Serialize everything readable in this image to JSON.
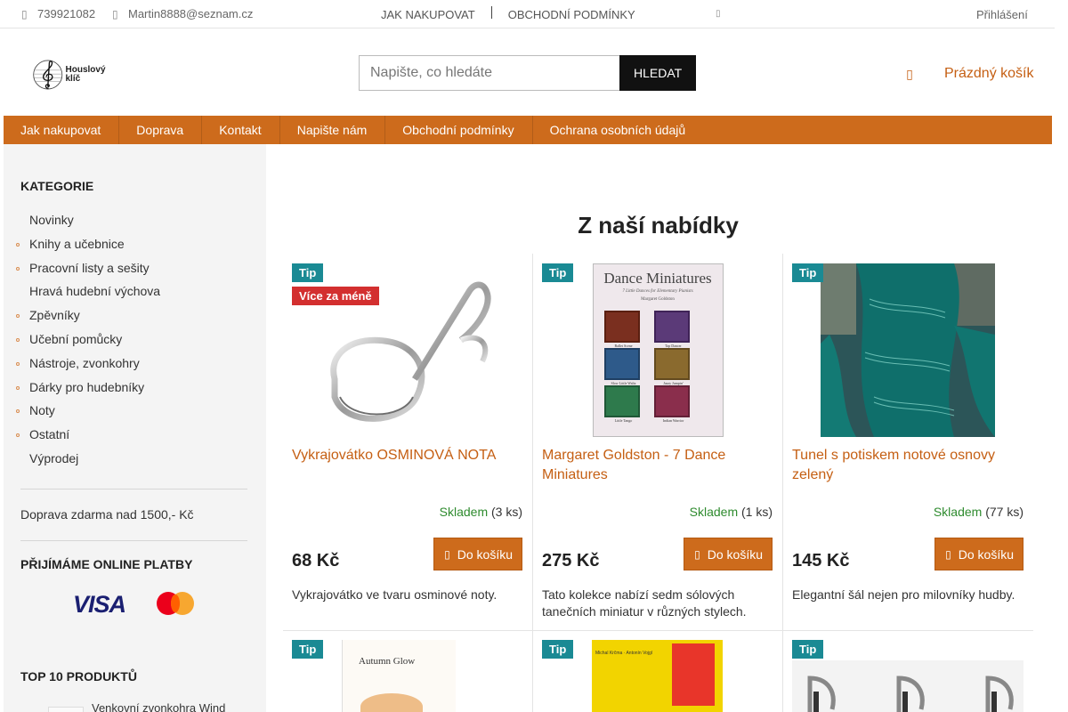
{
  "topbar": {
    "phone": "739921082",
    "email": "Martin8888@seznam.cz",
    "links": [
      "JAK NAKUPOVAT",
      "OBCHODNÍ PODMÍNKY"
    ],
    "login": "Přihlášení"
  },
  "header": {
    "logo_text": "Houslový klíč",
    "search_placeholder": "Napište, co hledáte",
    "search_button": "HLEDAT",
    "cart_text": "Prázdný košík"
  },
  "nav": [
    "Jak nakupovat",
    "Doprava",
    "Kontakt",
    "Napište nám",
    "Obchodní podmínky",
    "Ochrana osobních údajů"
  ],
  "sidebar": {
    "categories_heading": "KATEGORIE",
    "categories": [
      {
        "label": "Novinky",
        "bullet": false
      },
      {
        "label": "Knihy a učebnice",
        "bullet": true
      },
      {
        "label": "Pracovní listy a sešity",
        "bullet": true
      },
      {
        "label": "Hravá hudební výchova",
        "bullet": false
      },
      {
        "label": "Zpěvníky",
        "bullet": true
      },
      {
        "label": "Učební pomůcky",
        "bullet": true
      },
      {
        "label": "Nástroje, zvonkohry",
        "bullet": true
      },
      {
        "label": "Dárky pro hudebníky",
        "bullet": true
      },
      {
        "label": "Noty",
        "bullet": true
      },
      {
        "label": "Ostatní",
        "bullet": true
      },
      {
        "label": "Výprodej",
        "bullet": false
      }
    ],
    "shipping_note": "Doprava zdarma nad 1500,- Kč",
    "payments_heading": "PŘIJÍMÁME ONLINE PLATBY",
    "visa_text": "VISA",
    "top10_heading": "TOP 10 PRODUKTŮ",
    "top10_first": "Venkovní zvonkohra Wind"
  },
  "main": {
    "title": "Z naší nabídky",
    "products": [
      {
        "badges": [
          "Tip",
          "Více za méně"
        ],
        "name": "Vykrajovátko OSMINOVÁ NOTA",
        "stock_label": "Skladem",
        "stock_count": "(3 ks)",
        "price": "68 Kč",
        "buy": "Do košíku",
        "description": "Vykrajovátko ve tvaru osminové noty."
      },
      {
        "badges": [
          "Tip"
        ],
        "name": "Margaret Goldston - 7 Dance Miniatures",
        "stock_label": "Skladem",
        "stock_count": "(1 ks)",
        "price": "275 Kč",
        "buy": "Do košíku",
        "description": "Tato kolekce nabízí sedm sólových tanečních miniatur v různých stylech.",
        "cover_title": "Dance Miniatures",
        "cover_sub": "7 Little Dances for Elementary Pianists",
        "cover_author": "Margaret Goldston",
        "cover_tiles": [
          "Ballet Scene",
          "Tap Dancer",
          "Slow Little Waltz",
          "Jazzy Jumpin'",
          "Little Tango",
          "Indian Warrior"
        ]
      },
      {
        "badges": [
          "Tip"
        ],
        "name": "Tunel s potiskem notové osnovy zelený",
        "stock_label": "Skladem",
        "stock_count": "(77 ks)",
        "price": "145 Kč",
        "buy": "Do košíku",
        "description": "Elegantní šál nejen pro milovníky hudby."
      }
    ],
    "row2": [
      {
        "badge": "Tip",
        "cover_title": "Autumn Glow"
      },
      {
        "badge": "Tip",
        "cover_author": "Michal Krčma · Antonín Vojgl"
      },
      {
        "badge": "Tip"
      }
    ]
  }
}
